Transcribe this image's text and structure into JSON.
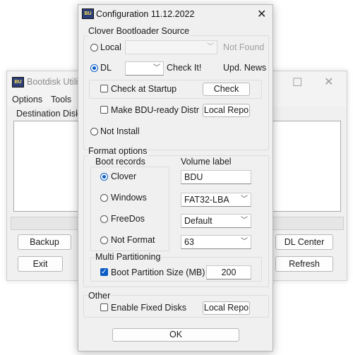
{
  "main_window": {
    "title": "Bootdisk Utility",
    "menu": [
      "Options",
      "Tools"
    ],
    "list_label": "Destination Disk",
    "buttons": {
      "backup": "Backup",
      "exit": "Exit",
      "dl_center": "DL Center",
      "refresh": "Refresh"
    }
  },
  "dialog": {
    "title": "Configuration 11.12.2022",
    "clover_source": {
      "group_label": "Clover Bootloader Source",
      "local_label": "Local",
      "local_status": "Not Found",
      "dl_label": "DL",
      "dl_link": "Check It!",
      "dl_news": "Upd. News",
      "check_startup_label": "Check at Startup",
      "check_button": "Check",
      "bdu_ready_label": "Make BDU-ready Distr",
      "local_repo_button": "Local Repo",
      "not_install_label": "Not Install"
    },
    "format_options": {
      "group_label": "Format options",
      "boot_records": {
        "group_label": "Boot records",
        "options": [
          "Clover",
          "Windows",
          "FreeDos",
          "Not Format"
        ],
        "selected": "Clover"
      },
      "volume_label_title": "Volume label",
      "volume_label_value": "BDU",
      "filesystem_value": "FAT32-LBA",
      "cluster_value": "Default",
      "heads_value": "63",
      "multi_partitioning": {
        "group_label": "Multi Partitioning",
        "boot_partition_label": "Boot Partition Size (MB)",
        "boot_partition_checked": true,
        "boot_partition_value": "200"
      }
    },
    "other": {
      "group_label": "Other",
      "fixed_disks_label": "Enable Fixed Disks",
      "local_repo_button": "Local Repo"
    },
    "ok_button": "OK"
  },
  "colors": {
    "accent": "#0a5bc4",
    "window_bg": "#f0f0f0"
  }
}
